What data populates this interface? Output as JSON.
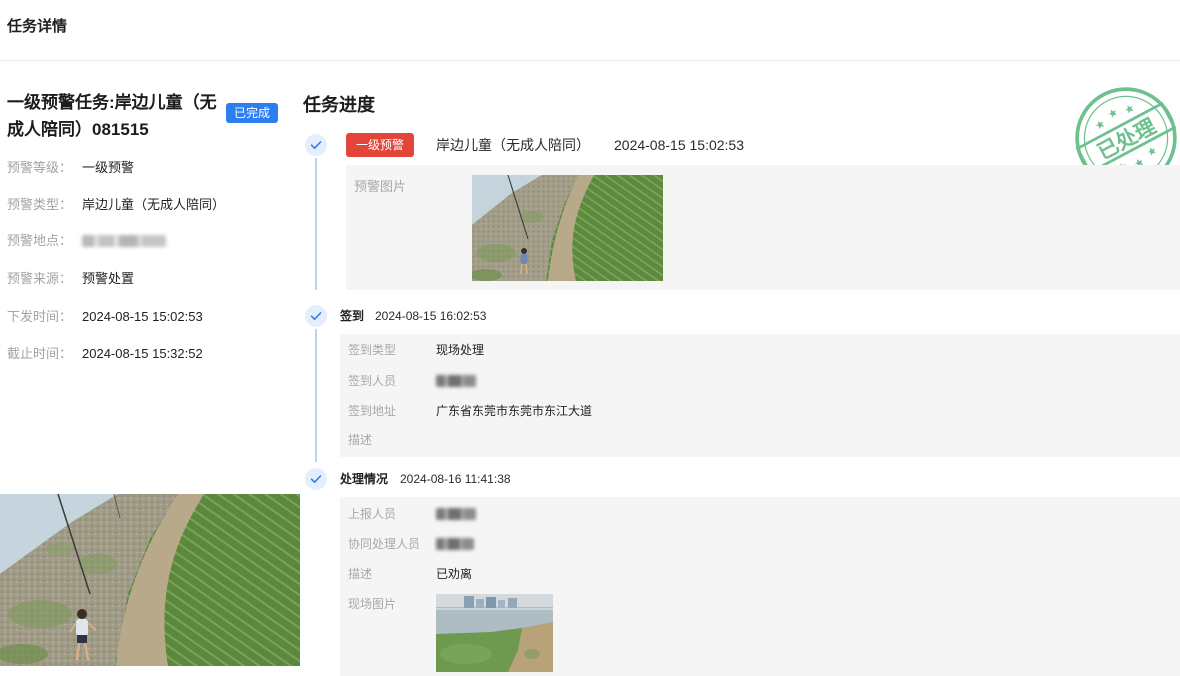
{
  "header": {
    "title": "任务详情"
  },
  "task": {
    "title": "一级预警任务:岸边儿童（无成人陪同）081515",
    "status": "已完成",
    "fields": [
      {
        "label": "预警等级：",
        "value": "一级预警"
      },
      {
        "label": "预警类型：",
        "value": "岸边儿童（无成人陪同）"
      },
      {
        "label": "预警地点："
      },
      {
        "label": "预警来源：",
        "value": "预警处置"
      },
      {
        "label": "下发时间：",
        "value": "2024-08-15 15:02:53"
      },
      {
        "label": "截止时间：",
        "value": "2024-08-15 15:32:52"
      }
    ]
  },
  "progress": {
    "heading": "任务进度",
    "stamp": "已处理",
    "steps": [
      {
        "badge": "一级预警",
        "title": "岸边儿童（无成人陪同）",
        "time": "2024-08-15 15:02:53",
        "details": [
          {
            "label": "预警图片"
          }
        ]
      },
      {
        "title": "签到",
        "time": "2024-08-15 16:02:53",
        "details": [
          {
            "label": "签到类型",
            "value": "现场处理"
          },
          {
            "label": "签到人员"
          },
          {
            "label": "签到地址",
            "value": "广东省东莞市东莞市东江大道"
          },
          {
            "label": "描述",
            "value": ""
          }
        ]
      },
      {
        "title": "处理情况",
        "time": "2024-08-16 11:41:38",
        "details": [
          {
            "label": "上报人员"
          },
          {
            "label": "协同处理人员"
          },
          {
            "label": "描述",
            "value": "已劝离"
          },
          {
            "label": "现场图片"
          }
        ]
      }
    ]
  },
  "icons": {
    "step_status": "check-icon"
  },
  "colors": {
    "accent_blue": "#2b7ff0",
    "danger_red": "#e3453a",
    "stamp_green": "#5fbb82",
    "timeline_line": "#b9d3f1",
    "check_bg": "#e4eefc",
    "panel_bg": "#f5f5f5"
  }
}
